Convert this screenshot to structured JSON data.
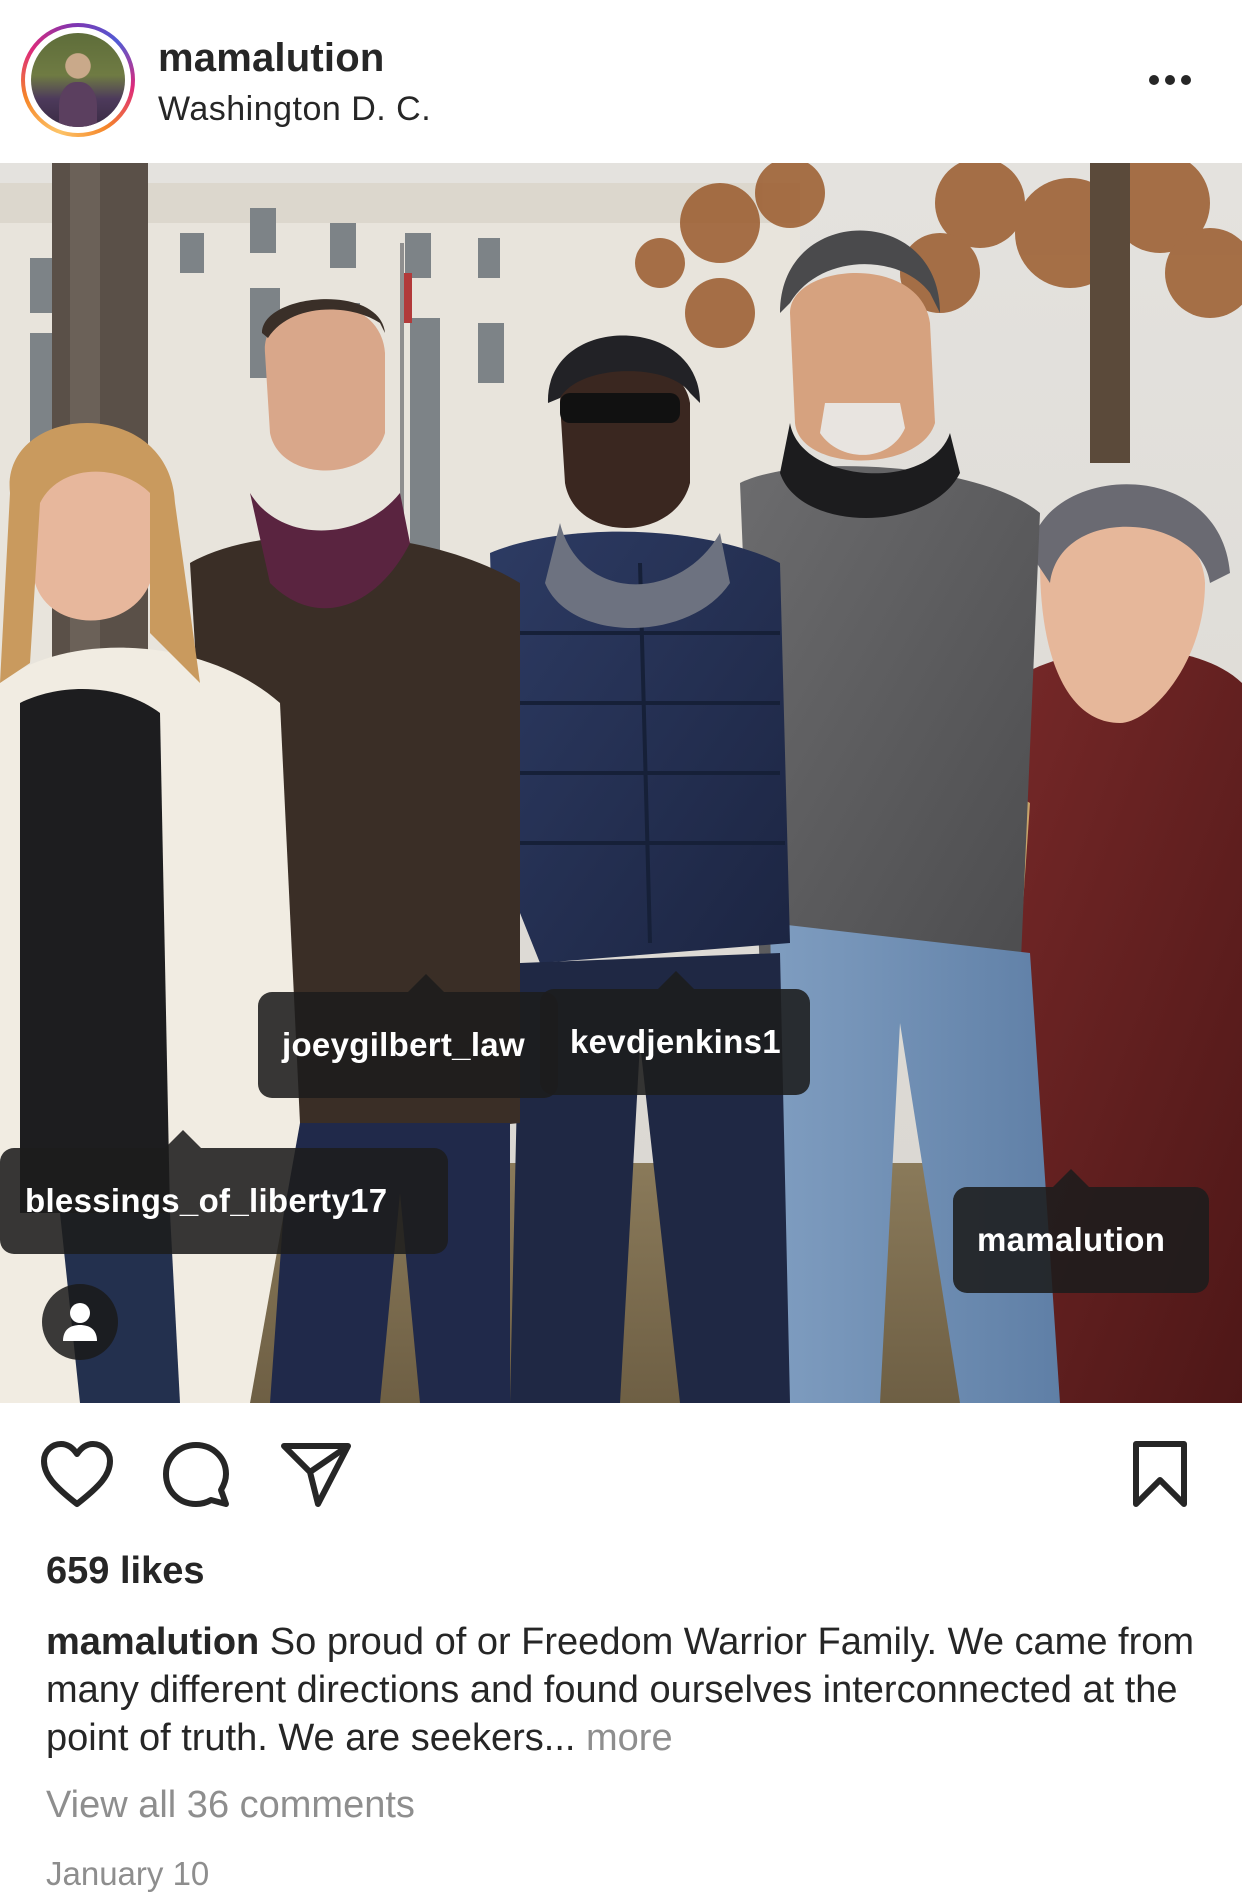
{
  "post": {
    "username": "mamalution",
    "location": "Washington D. C.",
    "more_icon": "more-horizontal-icon"
  },
  "tags": {
    "joey": "joeygilbert_law",
    "kev": "kevdjenkins1",
    "blessings": "blessings_of_liberty17",
    "mama": "mamalution"
  },
  "actions": {
    "like_icon": "heart-icon",
    "comment_icon": "comment-bubble-icon",
    "share_icon": "paper-plane-icon",
    "save_icon": "bookmark-icon",
    "tagged_icon": "person-icon"
  },
  "likes": "659 likes",
  "caption": {
    "username": "mamalution",
    "text": " So proud of or Freedom Warrior Family. We came from many different directions and found ourselves interconnected at the point of truth. We are seekers...",
    "more": " more"
  },
  "view_comments": "View all 36 comments",
  "date": "January 10",
  "colors": {
    "text": "#262626",
    "secondary": "#8e8e8e",
    "tag_bg": "#1c1c1c"
  }
}
